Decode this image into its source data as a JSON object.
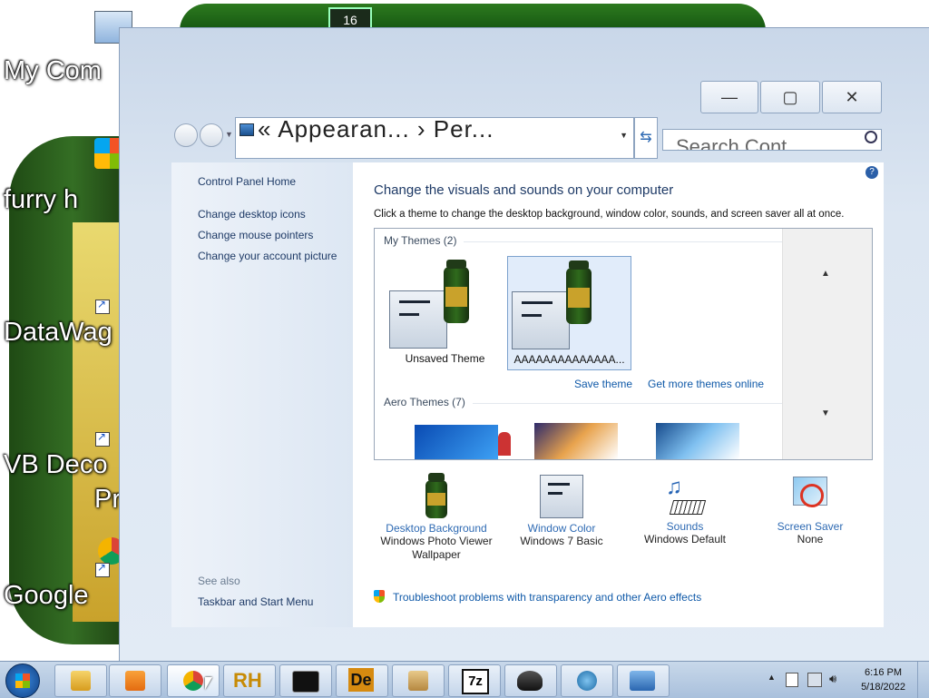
{
  "desktop": {
    "icons": [
      {
        "label": "My Com",
        "icon": "computer-icon"
      },
      {
        "label": "furry h",
        "icon": "windows-logo-icon"
      },
      {
        "label": "DataWag",
        "icon": "shortcut-icon"
      },
      {
        "label": "VB Deco",
        "label2": "Pr",
        "icon": "shortcut-icon"
      },
      {
        "label": "Google",
        "icon": "chrome-icon"
      }
    ],
    "badge": "16"
  },
  "window": {
    "address": "« Appearan... › Per...",
    "search_placeholder": "Search Cont...",
    "minimize": "—",
    "maximize": "▢",
    "close": "✕",
    "help": "?"
  },
  "sidebar": {
    "home": "Control Panel Home",
    "links": [
      "Change desktop icons",
      "Change mouse pointers",
      "Change your account picture"
    ],
    "see_also": "See also",
    "see_also_link": "Taskbar and Start Menu"
  },
  "main": {
    "title": "Change the visuals and sounds on your computer",
    "subtitle": "Click a theme to change the desktop background, window color, sounds, and screen saver all at once.",
    "my_themes": "My Themes (2)",
    "themes": [
      {
        "name": "Unsaved Theme"
      },
      {
        "name": "AAAAAAAAAAAAAA..."
      }
    ],
    "save_theme": "Save theme",
    "get_more": "Get more themes online",
    "aero_themes": "Aero Themes (7)",
    "bottom": [
      {
        "title": "Desktop Background",
        "sub": "Windows Photo Viewer Wallpaper",
        "icon": "desktop-background-icon"
      },
      {
        "title": "Window Color",
        "sub": "Windows 7 Basic",
        "icon": "window-color-icon"
      },
      {
        "title": "Sounds",
        "sub": "Windows Default",
        "icon": "sounds-icon"
      },
      {
        "title": "Screen Saver",
        "sub": "None",
        "icon": "screen-saver-icon"
      }
    ],
    "troubleshoot": "Troubleshoot problems with transparency and other Aero effects"
  },
  "taskbar": {
    "apps": [
      "explorer-icon",
      "media-player-icon",
      "chrome-icon",
      "rh-icon",
      "cmd-icon",
      "de-icon",
      "package-icon",
      "7z-icon",
      "wolf-icon",
      "globe-phone-icon",
      "control-panel-icon"
    ],
    "rh_text": "RH",
    "de_text": "De",
    "sevenz_text": "7z",
    "time": "6:16 PM",
    "date": "5/18/2022"
  },
  "colors": {
    "link": "#0f59a8",
    "accent": "#2e6ab3",
    "taskbar": "#b7cbe3"
  }
}
